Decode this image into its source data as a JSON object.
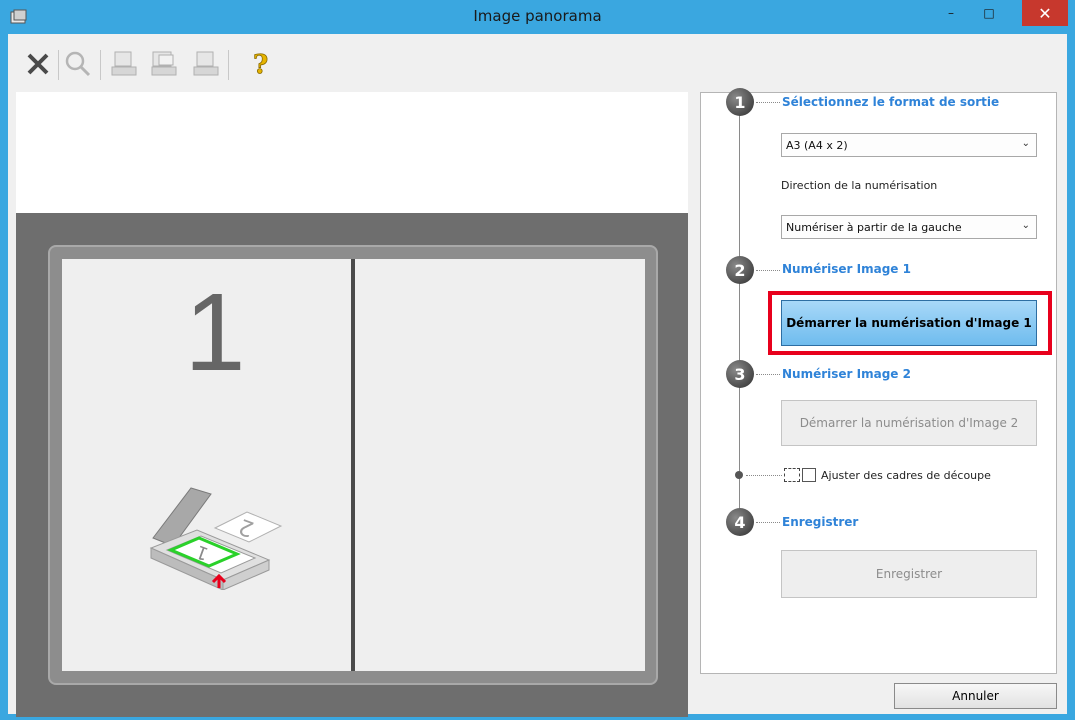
{
  "window": {
    "title": "Image panorama",
    "controls": {
      "minimize": "–",
      "maximize": "□",
      "close": "✕"
    }
  },
  "toolbar": {
    "items": [
      "close-icon",
      "zoom-icon",
      "scanner-a-icon",
      "scanner-b-icon",
      "scanner-c-icon",
      "help-icon"
    ]
  },
  "preview": {
    "page_number": "1"
  },
  "steps": [
    {
      "number": "1",
      "label": "Sélectionnez le format de sortie"
    },
    {
      "number": "2",
      "label": "Numériser Image 1"
    },
    {
      "number": "3",
      "label": "Numériser Image 2"
    },
    {
      "number": "4",
      "label": "Enregistrer"
    }
  ],
  "output_format": {
    "selected": "A3 (A4 x 2)"
  },
  "scan_direction": {
    "label": "Direction de la numérisation",
    "selected": "Numériser à partir de la gauche"
  },
  "buttons": {
    "scan_image1": "Démarrer la numérisation d'Image 1",
    "scan_image2": "Démarrer la numérisation d'Image 2",
    "save": "Enregistrer",
    "cancel": "Annuler"
  },
  "crop": {
    "label": "Ajuster des cadres de découpe",
    "checked": false
  },
  "colors": {
    "titlebar": "#3aa7e0",
    "step_label": "#2f83d8",
    "highlight": "#e8001c",
    "primary_button": "#6fbcee"
  }
}
